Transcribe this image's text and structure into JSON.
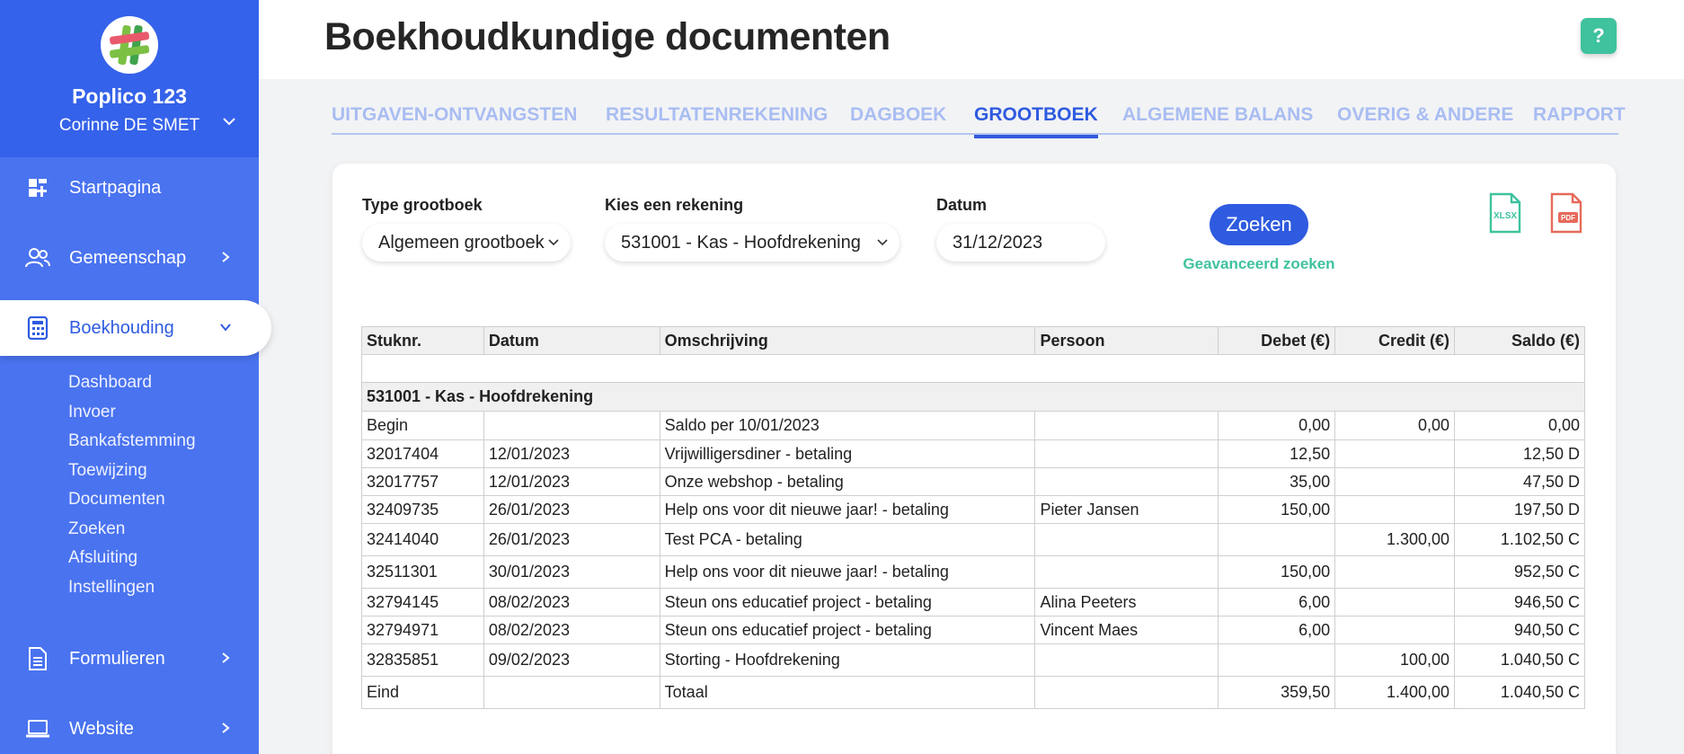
{
  "sidebar": {
    "org_name": "Poplico 123",
    "user_name": "Corinne DE SMET",
    "nav": [
      {
        "label": "Startpagina",
        "icon": "dashboard-icon"
      },
      {
        "label": "Gemeenschap",
        "icon": "community-icon"
      },
      {
        "label": "Boekhouding",
        "icon": "calculator-icon"
      },
      {
        "label": "Formulieren",
        "icon": "form-icon"
      },
      {
        "label": "Website",
        "icon": "laptop-icon"
      }
    ],
    "sub_items": [
      "Dashboard",
      "Invoer",
      "Bankafstemming",
      "Toewijzing",
      "Documenten",
      "Zoeken",
      "Afsluiting",
      "Instellingen"
    ]
  },
  "header": {
    "title": "Boekhoudkundige documenten",
    "help_label": "?"
  },
  "tabs": [
    {
      "label": "UITGAVEN-ONTVANGSTEN"
    },
    {
      "label": "RESULTATENREKENING"
    },
    {
      "label": "DAGBOEK"
    },
    {
      "label": "GROOTBOEK"
    },
    {
      "label": "ALGEMENE BALANS"
    },
    {
      "label": "OVERIG & ANDERE"
    },
    {
      "label": "RAPPORT"
    }
  ],
  "filters": {
    "type_label": "Type grootboek",
    "type_value": "Algemeen grootboek",
    "account_label": "Kies een rekening",
    "account_value": "531001 - Kas - Hoofdrekening",
    "date_label": "Datum",
    "date_value": "31/12/2023",
    "search_button": "Zoeken",
    "advanced_link": "Geavanceerd zoeken",
    "export_xlsx": "XLSX",
    "export_pdf": "PDF"
  },
  "table": {
    "columns": [
      "Stuknr.",
      "Datum",
      "Omschrijving",
      "Persoon",
      "Debet (€)",
      "Credit (€)",
      "Saldo (€)"
    ],
    "group_title": "531001 - Kas - Hoofdrekening",
    "rows": [
      [
        "Begin",
        "",
        "Saldo per 10/01/2023",
        "",
        "0,00",
        "0,00",
        "0,00"
      ],
      [
        "32017404",
        "12/01/2023",
        "Vrijwilligersdiner - betaling",
        "",
        "12,50",
        "",
        "12,50 D"
      ],
      [
        "32017757",
        "12/01/2023",
        "Onze webshop - betaling",
        "",
        "35,00",
        "",
        "47,50 D"
      ],
      [
        "32409735",
        "26/01/2023",
        "Help ons voor dit nieuwe jaar! - betaling",
        "Pieter Jansen",
        "150,00",
        "",
        "197,50 D"
      ],
      [
        "32414040",
        "26/01/2023",
        "Test PCA - betaling",
        "",
        "",
        "1.300,00",
        "1.102,50 C"
      ],
      [
        "32511301",
        "30/01/2023",
        "Help ons voor dit nieuwe jaar! - betaling",
        "",
        "150,00",
        "",
        "952,50 C"
      ],
      [
        "32794145",
        "08/02/2023",
        "Steun ons educatief project - betaling",
        "Alina Peeters",
        "6,00",
        "",
        "946,50 C"
      ],
      [
        "32794971",
        "08/02/2023",
        "Steun ons educatief project - betaling",
        "Vincent Maes",
        "6,00",
        "",
        "940,50 C"
      ],
      [
        "32835851",
        "09/02/2023",
        "Storting - Hoofdrekening",
        "",
        "",
        "100,00",
        "1.040,50 C"
      ],
      [
        "Eind",
        "",
        "Totaal",
        "",
        "359,50",
        "1.400,00",
        "1.040,50 C"
      ]
    ]
  }
}
